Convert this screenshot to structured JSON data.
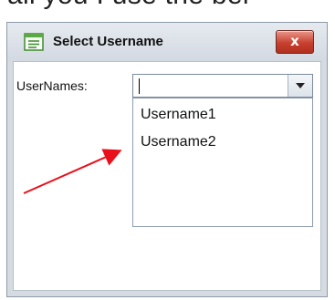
{
  "top_fragment": "ail you I use the bel",
  "window": {
    "title": "Select Username",
    "close_label": "x"
  },
  "form": {
    "field_label": "UserNames:",
    "combo_value": ""
  },
  "dropdown": {
    "items": [
      {
        "label": "Username1"
      },
      {
        "label": "Username2"
      }
    ]
  },
  "colors": {
    "annotation_arrow": "#e8101a",
    "close_button": "#c8402f"
  },
  "icons": {
    "title": "form-window-icon",
    "close": "close-icon",
    "dropdown": "chevron-down-icon"
  }
}
